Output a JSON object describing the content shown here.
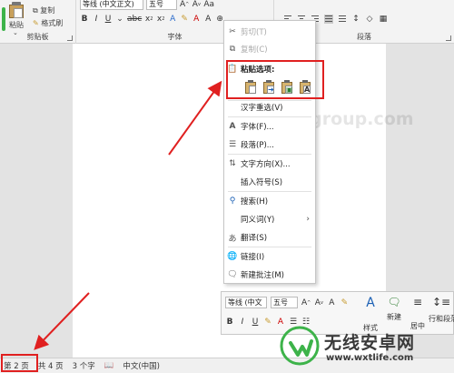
{
  "ribbon": {
    "clipboard": {
      "paste_label": "粘贴",
      "copy_label": "复制",
      "format_painter_label": "格式刷",
      "group_label": "剪贴板"
    },
    "font": {
      "font_name": "等线 (中文正文)",
      "font_size": "五号",
      "group_label": "字体"
    },
    "paragraph": {
      "group_label": "段落"
    }
  },
  "context_menu": {
    "cut": "剪切(T)",
    "copy": "复制(C)",
    "paste_options": "粘贴选项:",
    "hanzi_reselect": "汉字重选(V)",
    "font": "字体(F)...",
    "paragraph": "段落(P)...",
    "text_direction": "文字方向(X)...",
    "insert_symbol": "插入符号(S)",
    "search": "搜索(H)",
    "synonyms": "同义词(Y)",
    "translate": "翻译(S)",
    "link": "链接(I)",
    "new_comment": "新建批注(M)"
  },
  "mini_toolbar": {
    "font_name": "等线 (中文",
    "font_size": "五号",
    "styles_label": "样式",
    "new_comment_label": "新建",
    "center_label": "居中",
    "line_spacing_label": "行和段落"
  },
  "status_bar": {
    "page": "第 2 页",
    "total": "共 4 页",
    "words": "3 个字",
    "language": "中文(中国)"
  },
  "watermark": {
    "title": "无线安卓网",
    "url": "www.wxtlife.com",
    "bg_text": "wjhotelgroup.com"
  },
  "colors": {
    "accent_green": "#3db34a",
    "highlight_red": "#e02020",
    "link_blue": "#1a5fb4"
  }
}
